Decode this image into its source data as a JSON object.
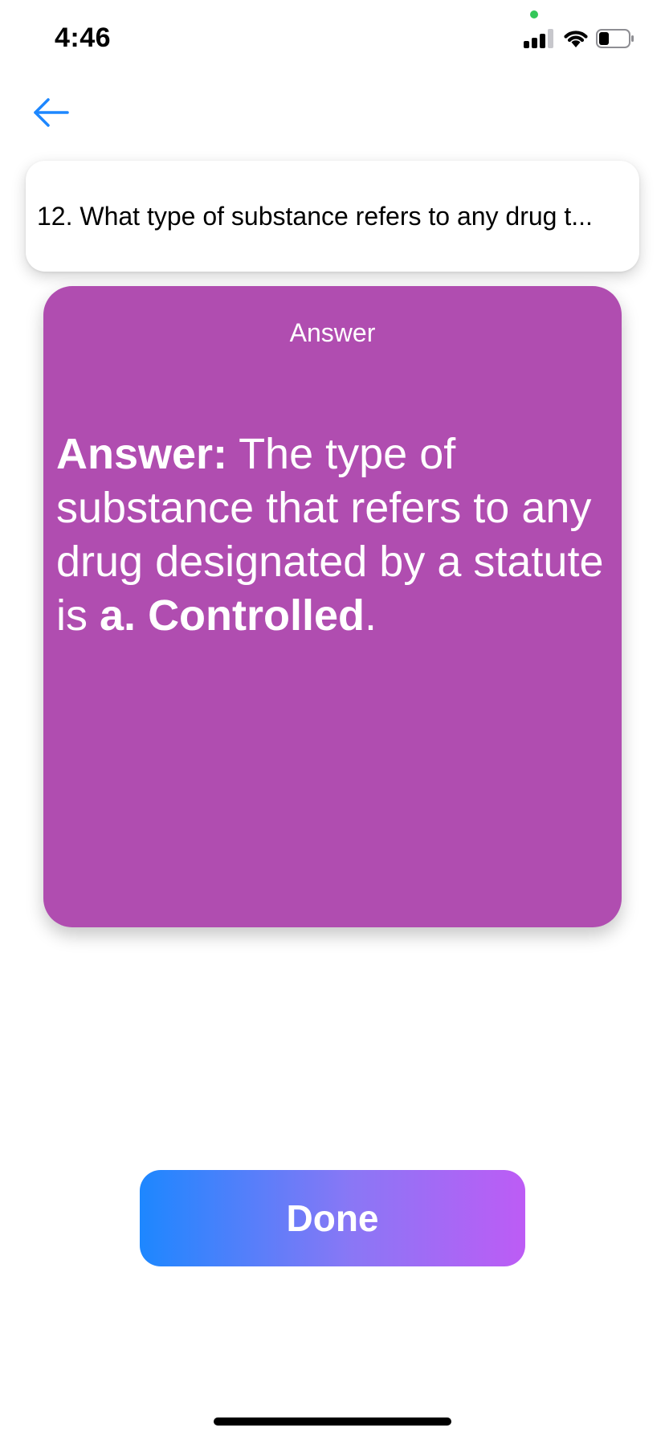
{
  "status_bar": {
    "time": "4:46"
  },
  "question": {
    "text": "12. What type of substance refers to any drug t..."
  },
  "answer_card": {
    "header": "Answer",
    "label": "Answer:",
    "text_before": " The type of substance that refers to any drug designated by a statute is ",
    "option_letter": "a.",
    "option_value": "Controlled",
    "text_after": ".",
    "background_color": "#b04db0"
  },
  "done_button": {
    "label": "Done"
  },
  "colors": {
    "accent": "#1d87ff",
    "gradient_end": "#bd5cf5"
  }
}
